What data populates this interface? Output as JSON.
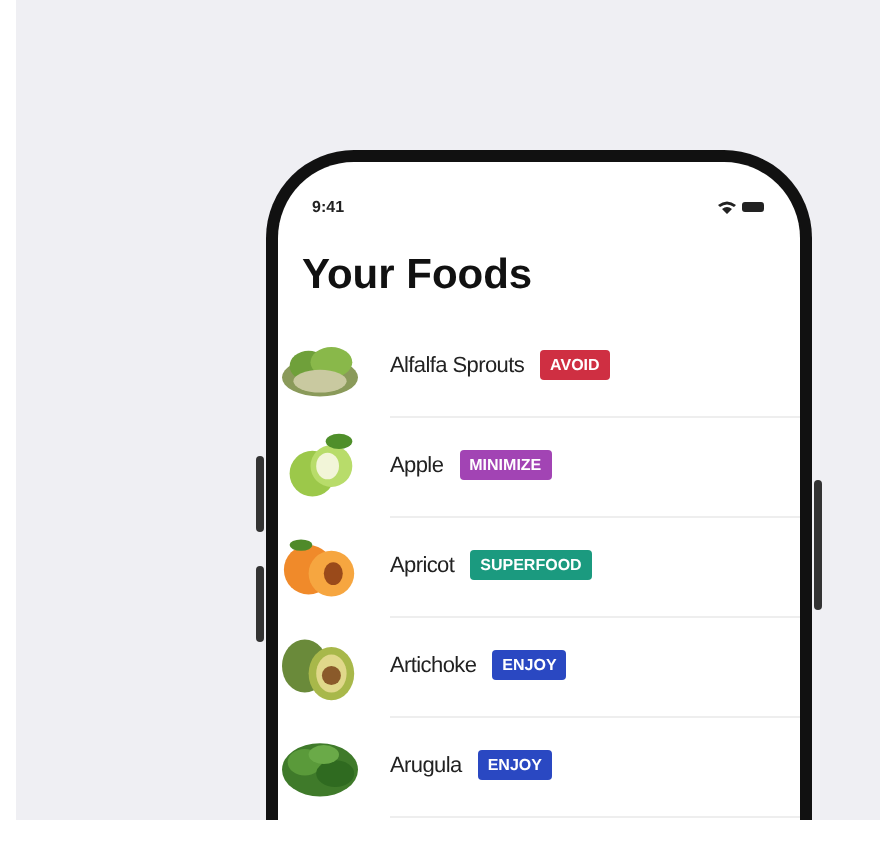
{
  "status_bar": {
    "time": "9:41"
  },
  "title": "Your Foods",
  "foods": [
    {
      "name": "Alfalfa Sprouts",
      "tag": "AVOID",
      "color": "#cf2f42"
    },
    {
      "name": "Apple",
      "tag": "MINIMIZE",
      "color": "#a244b4"
    },
    {
      "name": "Apricot",
      "tag": "SUPERFOOD",
      "color": "#1b9a7f"
    },
    {
      "name": "Artichoke",
      "tag": "ENJOY",
      "color": "#2a48c2"
    },
    {
      "name": "Arugula",
      "tag": "ENJOY",
      "color": "#2a48c2"
    }
  ]
}
